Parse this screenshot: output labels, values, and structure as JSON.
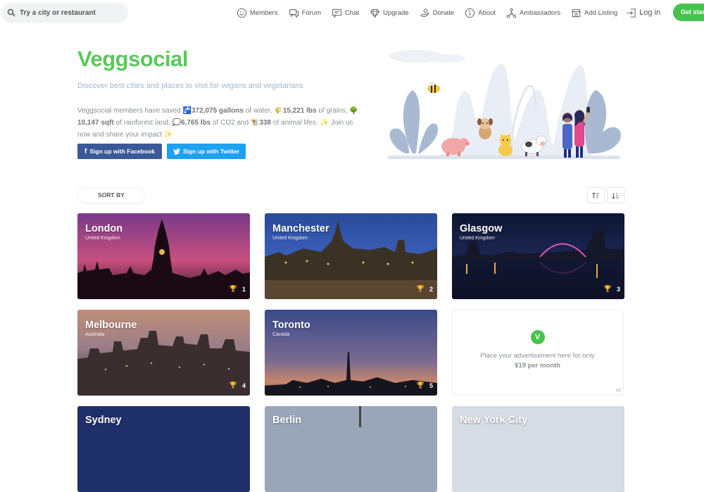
{
  "search": {
    "placeholder": "Try a city or restaurant"
  },
  "nav": {
    "links": [
      {
        "label": "Members",
        "icon": "smiley-icon"
      },
      {
        "label": "Forum",
        "icon": "forum-icon"
      },
      {
        "label": "Chat",
        "icon": "chat-icon"
      },
      {
        "label": "Upgrade",
        "icon": "diamond-icon"
      },
      {
        "label": "Donate",
        "icon": "donate-icon"
      },
      {
        "label": "About",
        "icon": "info-icon"
      },
      {
        "label": "Ambassadors",
        "icon": "network-icon"
      },
      {
        "label": "Add Listing",
        "icon": "storefront-icon"
      }
    ],
    "login": "Log in",
    "get_started": "Get started"
  },
  "hero": {
    "brand": "Veggsocial",
    "tagline": "Discover best cities and places to visit for vegans and vegetarians",
    "impact": {
      "intro": "Veggsocial members have saved",
      "water_value": "372,075 gallons",
      "water_suffix": "of water,",
      "grains_value": "15,221 lbs",
      "grains_suffix": "of grains,",
      "forest_value": "10,147 sqft",
      "forest_suffix": "of rainforest land,",
      "co2_value": "6,765 lbs",
      "co2_suffix": "of CO2 and",
      "animals_value": "338",
      "animals_suffix": "of animal lifes.",
      "cta": "Join us now and share your impact"
    },
    "facebook_button": "Sign up with Facebook",
    "twitter_button": "Sign up with Twitter"
  },
  "sort": {
    "label": "SORT BY"
  },
  "cities": [
    {
      "name": "London",
      "country": "United Kingdom",
      "rank": "1"
    },
    {
      "name": "Manchester",
      "country": "United Kingdom",
      "rank": "2"
    },
    {
      "name": "Glasgow",
      "country": "United Kingdom",
      "rank": "3"
    },
    {
      "name": "Melbourne",
      "country": "Australia",
      "rank": "4"
    },
    {
      "name": "Toronto",
      "country": "Canada",
      "rank": "5"
    },
    {
      "name": "Sydney",
      "country": "",
      "rank": ""
    },
    {
      "name": "Berlin",
      "country": "",
      "rank": ""
    },
    {
      "name": "New York City",
      "country": "",
      "rank": ""
    }
  ],
  "ad": {
    "logo": "V",
    "text": "Place your advertisement here for only",
    "price": "$19 per month",
    "tag": "ad"
  },
  "colors": {
    "brand_green": "#5ac85c",
    "facebook": "#3b5998",
    "twitter": "#1da1f2",
    "cta_green": "#45c34c"
  }
}
